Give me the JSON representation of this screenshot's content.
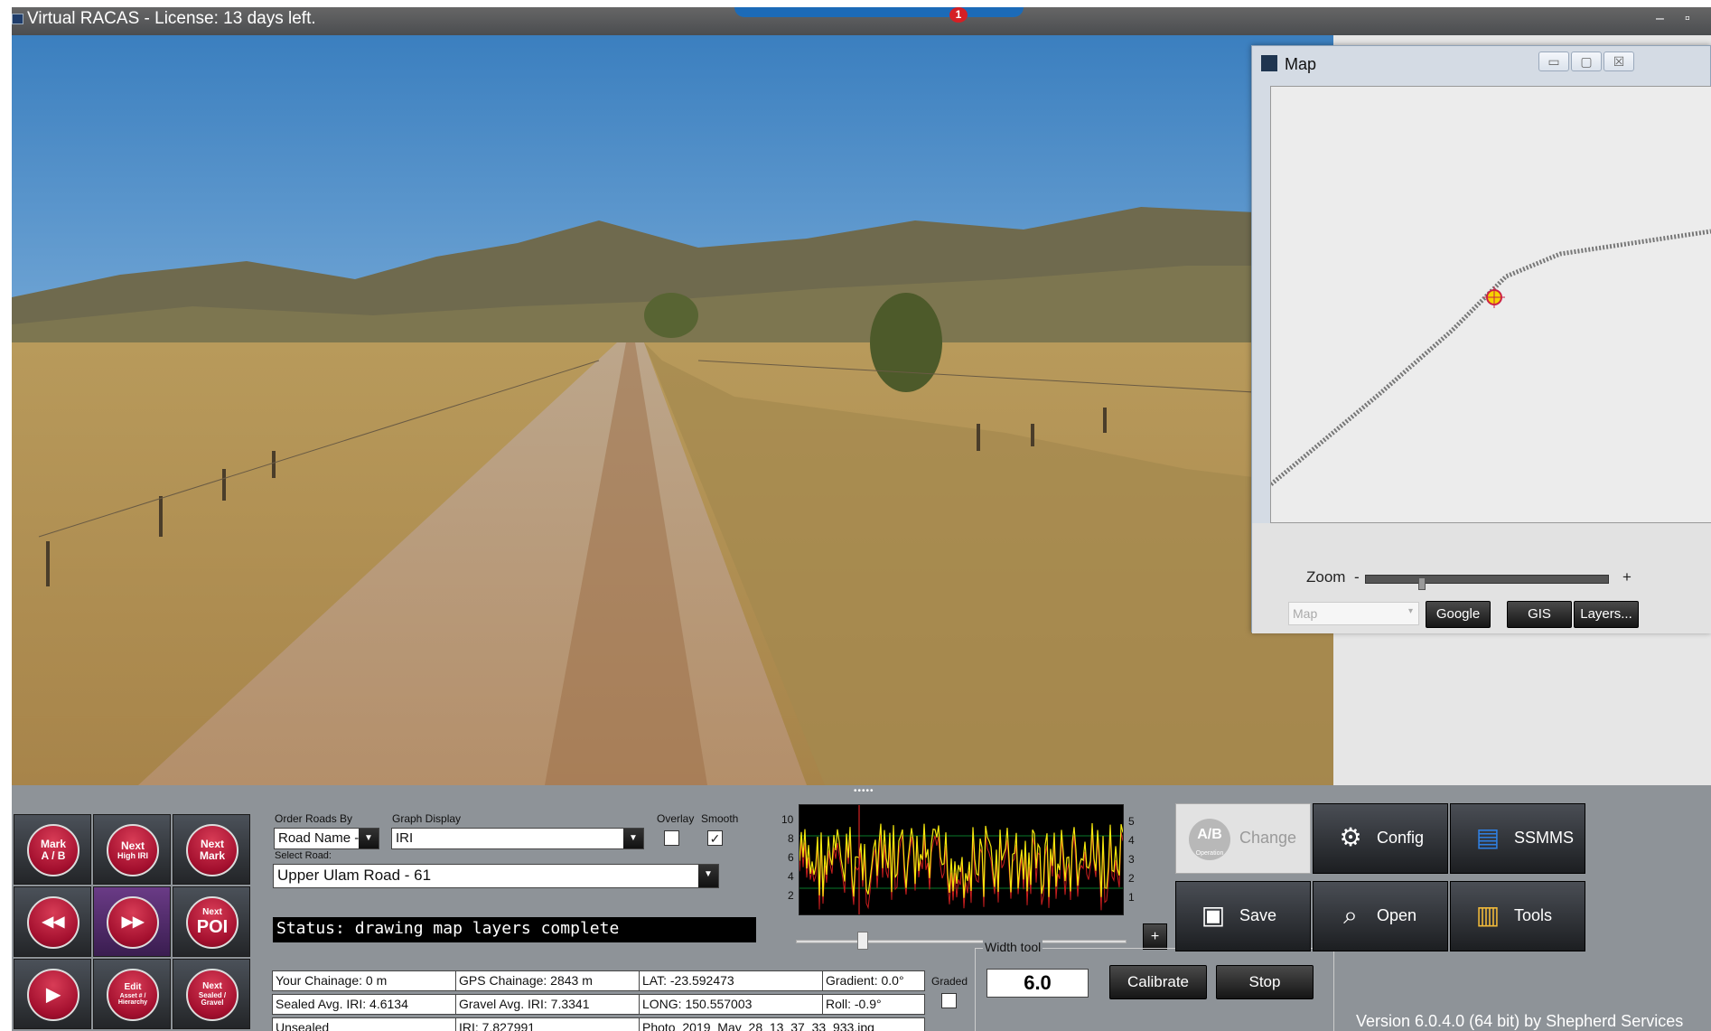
{
  "window": {
    "title": "Virtual RACAS - License: 13 days left.",
    "taskbar_badge": "1",
    "min_glyph": "–",
    "restore_glyph": "▫"
  },
  "map_window": {
    "title": "Map",
    "zoom_label": "Zoom",
    "zoom_minus": "-",
    "zoom_plus": "+",
    "zoom_level": 0.22,
    "layer_select": "Map",
    "google_label": "Google",
    "gis_label": "GIS",
    "layers_label": "Layers...",
    "min_glyph": "▭",
    "max_glyph": "▢",
    "close_glyph": "☒"
  },
  "controls": {
    "mark_ab": [
      "Mark",
      "A / B"
    ],
    "next_high_iri": [
      "Next",
      "High IRI"
    ],
    "next_mark": [
      "Next",
      "Mark"
    ],
    "rewind": "◀◀",
    "fast_forward": "▶▶",
    "next_poi": [
      "Next",
      "POI"
    ],
    "play": "▶",
    "edit_asset": [
      "Edit",
      "Asset # / Hierarchy"
    ],
    "next_sealed_gravel": [
      "Next",
      "Sealed / Gravel"
    ]
  },
  "options": {
    "order_roads_by_label": "Order Roads By",
    "order_roads_by_value": "Road Name - ",
    "graph_display_label": "Graph Display",
    "graph_display_value": "IRI",
    "overlay_label": "Overlay",
    "overlay_checked": false,
    "smooth_label": "Smooth",
    "smooth_checked": true,
    "check_glyph": "✓",
    "select_road_label": "Select Road:",
    "select_road_value": "Upper Ulam Road - 61"
  },
  "status": "Status: drawing map layers complete",
  "graph": {
    "left_ticks": [
      "10",
      "8",
      "6",
      "4",
      "2"
    ],
    "right_ticks": [
      "5",
      "4",
      "3",
      "2",
      "1"
    ],
    "plus_label": "+"
  },
  "info": {
    "your_chainage": "Your Chainage: 0 m",
    "gps_chainage": "GPS Chainage: 2843 m",
    "lat": "LAT: -23.592473",
    "gradient": "Gradient: 0.0°",
    "sealed_avg": "Sealed Avg. IRI: 4.6134",
    "gravel_avg": "Gravel Avg. IRI: 7.3341",
    "long": "LONG: 150.557003",
    "roll": "Roll: -0.9°",
    "surface": "Unsealed",
    "iri": "IRI: 7.827991",
    "photo": "Photo_2019_May_28_13_37_33_933.jpg",
    "graded_label": "Graded",
    "graded_checked": false
  },
  "width_tool": {
    "label": "Width tool",
    "value": "6.0",
    "calibrate_label": "Calibrate",
    "stop_label": "Stop"
  },
  "actions": {
    "ab_icon_text": "A/B",
    "ab_icon_sub": "Operation",
    "change_label": "Change",
    "config_label": "Config",
    "ssmms_label": "SSMMS",
    "save_label": "Save",
    "open_label": "Open",
    "tools_label": "Tools"
  },
  "version": "Version 6.0.4.0 (64 bit) by Shepherd Services"
}
